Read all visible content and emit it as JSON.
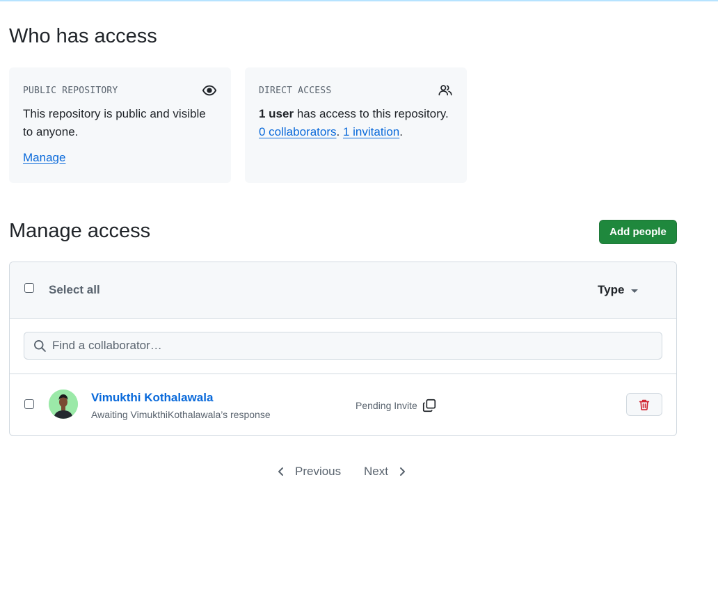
{
  "who_has_access": {
    "title": "Who has access",
    "public_card": {
      "label": "PUBLIC REPOSITORY",
      "icon": "eye-icon",
      "text": "This repository is public and visible to anyone.",
      "link": "Manage"
    },
    "direct_card": {
      "label": "DIRECT ACCESS",
      "icon": "people-icon",
      "count_bold": "1 user",
      "count_rest": " has access to this repository.",
      "collaborators_link": "0 collaborators",
      "sep": ". ",
      "invitation_link": "1 invitation",
      "end": "."
    }
  },
  "manage_access": {
    "title": "Manage access",
    "add_button": "Add people",
    "select_all": "Select all",
    "type_filter": "Type",
    "search_placeholder": "Find a collaborator…",
    "rows": [
      {
        "name": "Vimukthi Kothalawala",
        "subtitle": "Awaiting VimukthiKothalawala’s response",
        "status": "Pending Invite"
      }
    ]
  },
  "pagination": {
    "previous": "Previous",
    "next": "Next"
  },
  "colors": {
    "accent_link": "#0969da",
    "primary_button": "#1f883d",
    "danger": "#cf222e"
  }
}
